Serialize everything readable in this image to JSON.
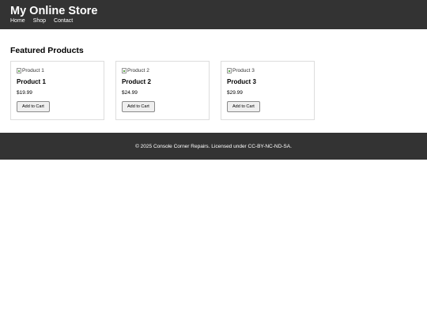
{
  "header": {
    "title": "My Online Store",
    "nav": [
      {
        "label": "Home"
      },
      {
        "label": "Shop"
      },
      {
        "label": "Contact"
      }
    ]
  },
  "main": {
    "section_title": "Featured Products",
    "products": [
      {
        "image_alt": "Product 1",
        "name": "Product 1",
        "price": "$19.99",
        "button_label": "Add to Cart"
      },
      {
        "image_alt": "Product 2",
        "name": "Product 2",
        "price": "$24.99",
        "button_label": "Add to Cart"
      },
      {
        "image_alt": "Product 3",
        "name": "Product 3",
        "price": "$29.99",
        "button_label": "Add to Cart"
      }
    ]
  },
  "footer": {
    "text": "© 2025 Console Corner Repairs. Licensed under CC-BY-NC-ND-SA."
  },
  "colors": {
    "header_bg": "#333333",
    "footer_bg": "#333333",
    "card_border": "#dddddd"
  }
}
